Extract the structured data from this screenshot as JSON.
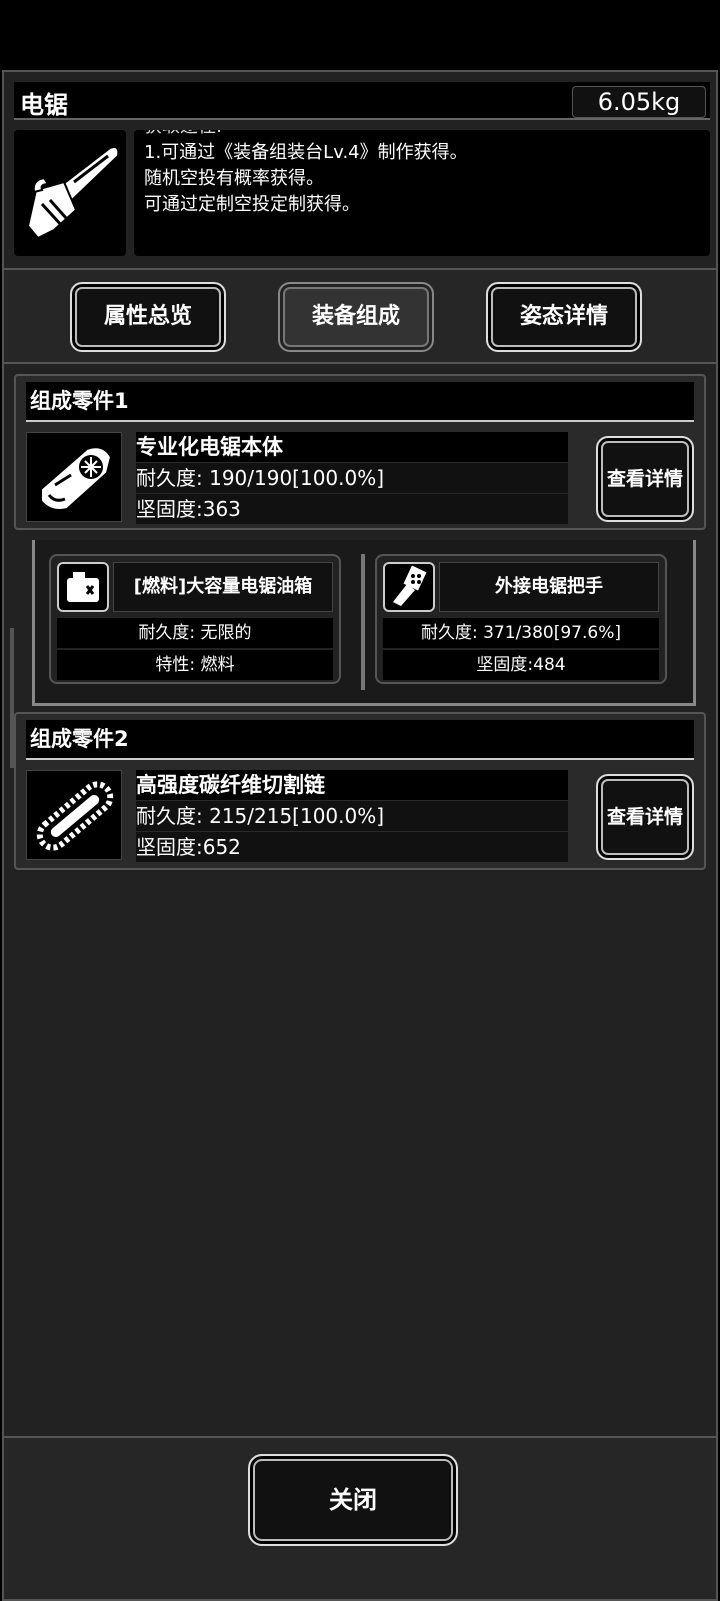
{
  "item": {
    "name": "电锯",
    "weight": "6.05kg",
    "description_cut": "获取途径:",
    "description": [
      "1.可通过《装备组装台Lv.4》制作获得。",
      "随机空投有概率获得。",
      "可通过定制空投定制获得。"
    ]
  },
  "tabs": [
    {
      "label": "属性总览"
    },
    {
      "label": "装备组成"
    },
    {
      "label": "姿态详情"
    }
  ],
  "components": [
    {
      "header": "组成零件1",
      "name": "专业化电锯本体",
      "durability": "耐久度: 190/190[100.0%]",
      "hardness": "坚固度:363",
      "detail_label": "查看详情",
      "icon": "chainsaw-body-icon"
    },
    {
      "header": "组成零件2",
      "name": "高强度碳纤维切割链",
      "durability": "耐久度: 215/215[100.0%]",
      "hardness": "坚固度:652",
      "detail_label": "查看详情",
      "icon": "cutting-chain-icon"
    }
  ],
  "subparts": [
    {
      "name": "[燃料]大容量电锯油箱",
      "row1": "耐久度: 无限的",
      "row2": "特性: 燃料",
      "icon": "fuel-tank-icon"
    },
    {
      "name": "外接电锯把手",
      "row1": "耐久度: 371/380[97.6%]",
      "row2": "坚固度:484",
      "icon": "handle-icon"
    }
  ],
  "footer": {
    "close_label": "关闭"
  }
}
